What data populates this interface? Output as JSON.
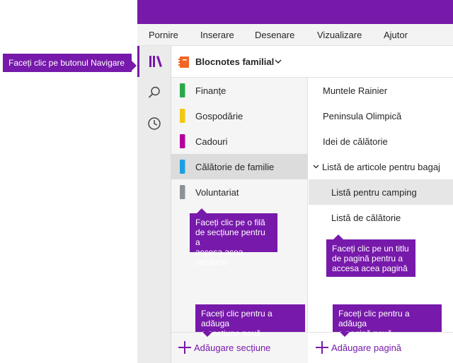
{
  "colors": {
    "accent": "#7719aa",
    "section_finance": "#2ba84a",
    "section_household": "#f2c811",
    "section_gifts": "#b4009e",
    "section_family_travel": "#1ba1e2",
    "section_volunteer": "#8a9399",
    "notebook_icon": "#f26522"
  },
  "menu": {
    "items": [
      "Pornire",
      "Inserare",
      "Desenare",
      "Vizualizare",
      "Ajutor"
    ]
  },
  "navrail": {
    "icons": [
      "notebooks-icon",
      "search-icon",
      "recent-icon"
    ]
  },
  "notebook": {
    "title": "Blocnotes familial",
    "icon": "notebook-icon"
  },
  "sections": [
    {
      "label": "Finanțe",
      "color": "#2ba84a",
      "selected": false
    },
    {
      "label": "Gospodărie",
      "color": "#f2c811",
      "selected": false
    },
    {
      "label": "Cadouri",
      "color": "#b4009e",
      "selected": false
    },
    {
      "label": "Călătorie de familie",
      "color": "#1ba1e2",
      "selected": true
    },
    {
      "label": "Voluntariat",
      "color": "#8a9399",
      "selected": false
    }
  ],
  "pages": [
    {
      "label": "Muntele Rainier",
      "level": 0,
      "selected": false,
      "expanded": false
    },
    {
      "label": "Peninsula Olimpică",
      "level": 0,
      "selected": false,
      "expanded": false
    },
    {
      "label": "Idei de călătorie",
      "level": 0,
      "selected": false,
      "expanded": false
    },
    {
      "label": "Listă de articole pentru bagaj",
      "level": 0,
      "selected": false,
      "expanded": true
    },
    {
      "label": "Listă pentru camping",
      "level": 1,
      "selected": true,
      "expanded": false
    },
    {
      "label": "Listă de călătorie",
      "level": 1,
      "selected": false,
      "expanded": false
    }
  ],
  "add": {
    "section_label": "Adăugare secțiune",
    "page_label": "Adăugare pagină"
  },
  "callouts": {
    "nav": "Faceți clic pe butonul Navigare",
    "section_tab": [
      "Faceți clic pe o filă",
      "de secțiune pentru a",
      "accesa acea secțiune"
    ],
    "page_title": [
      "Faceți clic pe un titlu",
      "de pagină pentru a",
      "accesa acea pagină"
    ],
    "add_section": [
      "Faceți clic pentru a adăuga",
      "o secțiune nouă"
    ],
    "add_page": [
      "Faceți clic pentru a adăuga",
      "o pagină nouă"
    ]
  }
}
